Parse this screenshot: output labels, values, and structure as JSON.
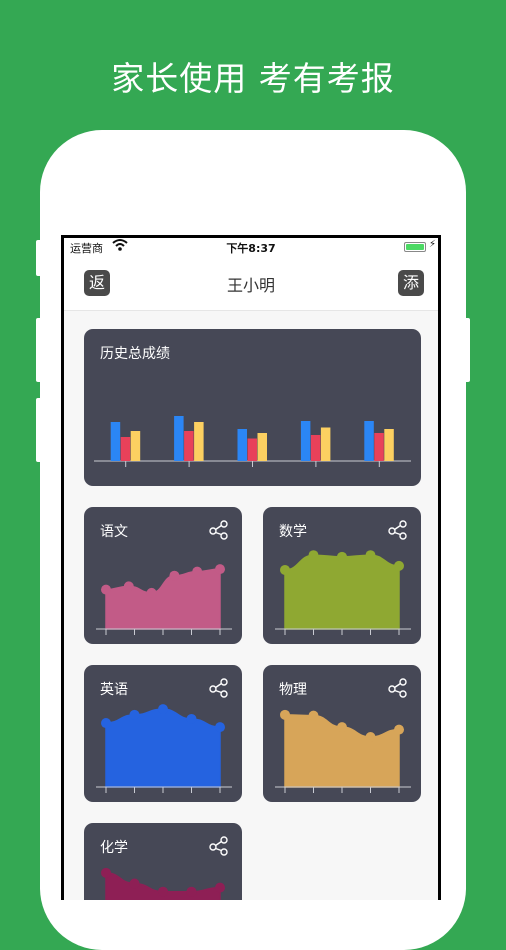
{
  "promo": {
    "headline": "家长使用 考有考报"
  },
  "statusbar": {
    "carrier": "运营商",
    "time": "下午8:37",
    "charging": "⚡"
  },
  "navbar": {
    "back_label": "返",
    "title": "王小明",
    "add_label": "添"
  },
  "colors": {
    "background": "#34a853",
    "card": "#464856",
    "bar_blue": "#2b86f5",
    "bar_red": "#e8415a",
    "bar_yellow": "#fcd061",
    "chinese": "#c25b87",
    "math": "#8fa832",
    "english": "#2563e0",
    "physics": "#d7a559",
    "chemistry": "#8e1f55"
  },
  "history": {
    "title": "历史总成绩"
  },
  "subjects": [
    {
      "name": "语文",
      "key": "chinese"
    },
    {
      "name": "数学",
      "key": "math"
    },
    {
      "name": "英语",
      "key": "english"
    },
    {
      "name": "物理",
      "key": "physics"
    },
    {
      "name": "化学",
      "key": "chemistry"
    }
  ],
  "chart_data": [
    {
      "type": "bar",
      "categories": [
        "",
        "",
        "",
        "",
        ""
      ],
      "series": [
        {
          "values": [
            78,
            90,
            64,
            80,
            80
          ]
        },
        {
          "values": [
            48,
            60,
            45,
            52,
            56
          ]
        },
        {
          "values": [
            60,
            78,
            56,
            67,
            64
          ]
        }
      ],
      "ylim": [
        0,
        100
      ]
    },
    {
      "type": "area",
      "x": [
        1,
        2,
        3,
        4,
        5,
        6
      ],
      "values": [
        48,
        52,
        44,
        65,
        70,
        73
      ],
      "ylim": [
        0,
        100
      ]
    },
    {
      "type": "area",
      "x": [
        1,
        2,
        3,
        4,
        5
      ],
      "values": [
        72,
        90,
        88,
        90,
        77
      ],
      "ylim": [
        0,
        100
      ]
    },
    {
      "type": "area",
      "x": [
        1,
        2,
        3,
        4,
        5
      ],
      "values": [
        78,
        88,
        95,
        83,
        73
      ],
      "ylim": [
        0,
        100
      ]
    },
    {
      "type": "area",
      "x": [
        1,
        2,
        3,
        4,
        5
      ],
      "values": [
        88,
        87,
        73,
        61,
        70
      ],
      "ylim": [
        0,
        100
      ]
    },
    {
      "type": "area",
      "x": [
        1,
        2,
        3,
        4,
        5
      ],
      "values": [
        88,
        75,
        65,
        65,
        70
      ],
      "ylim": [
        0,
        100
      ]
    }
  ]
}
